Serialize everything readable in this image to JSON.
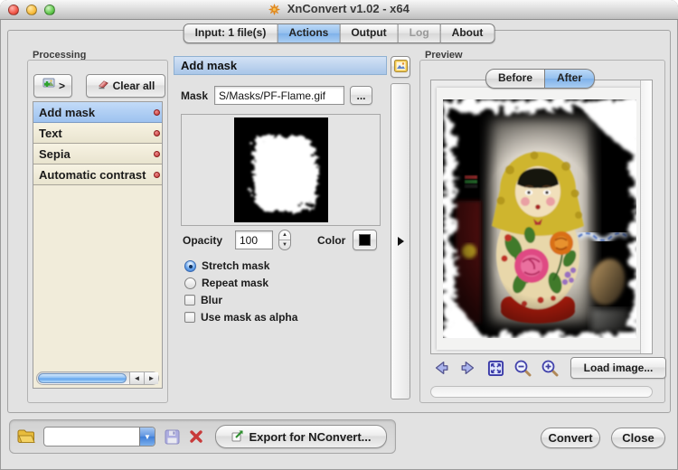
{
  "window": {
    "title": "XnConvert v1.02 - x64"
  },
  "tabs": [
    {
      "label": "Input: 1 file(s)",
      "state": "normal"
    },
    {
      "label": "Actions",
      "state": "selected"
    },
    {
      "label": "Output",
      "state": "normal"
    },
    {
      "label": "Log",
      "state": "disabled"
    },
    {
      "label": "About",
      "state": "normal"
    }
  ],
  "processing": {
    "group_label": "Processing",
    "add_button_label": ">",
    "clear_all_label": "Clear all",
    "items": [
      {
        "label": "Add mask",
        "selected": true
      },
      {
        "label": "Text",
        "selected": false
      },
      {
        "label": "Sepia",
        "selected": false
      },
      {
        "label": "Automatic contrast",
        "selected": false
      }
    ]
  },
  "action_panel": {
    "title": "Add mask",
    "mask_label": "Mask",
    "mask_path": "S/Masks/PF-Flame.gif",
    "browse_label": "...",
    "opacity_label": "Opacity",
    "opacity_value": "100",
    "color_label": "Color",
    "color_value": "#000000",
    "options": [
      {
        "type": "radio",
        "label": "Stretch mask",
        "checked": true
      },
      {
        "type": "radio",
        "label": "Repeat mask",
        "checked": false
      },
      {
        "type": "checkbox",
        "label": "Blur",
        "checked": false
      },
      {
        "type": "checkbox",
        "label": "Use mask as alpha",
        "checked": false
      }
    ]
  },
  "preview": {
    "group_label": "Preview",
    "tabs": [
      {
        "label": "Before",
        "selected": false
      },
      {
        "label": "After",
        "selected": true
      }
    ],
    "nav_icons": [
      "previous",
      "next",
      "fit-to-window",
      "zoom-out",
      "zoom-in"
    ],
    "load_image_label": "Load image..."
  },
  "bottom_bar": {
    "icons": [
      "folder-open",
      "save-script",
      "delete-script",
      "export"
    ],
    "script_value": "",
    "export_label": "Export for NConvert...",
    "convert_label": "Convert",
    "close_label": "Close"
  },
  "colors": {
    "selected_tab": "#8fbbee",
    "list_selection": "#9dc2ef",
    "header_blue": "#a9c6e8",
    "badge_red": "#c03030",
    "mask_color": "#000000"
  }
}
